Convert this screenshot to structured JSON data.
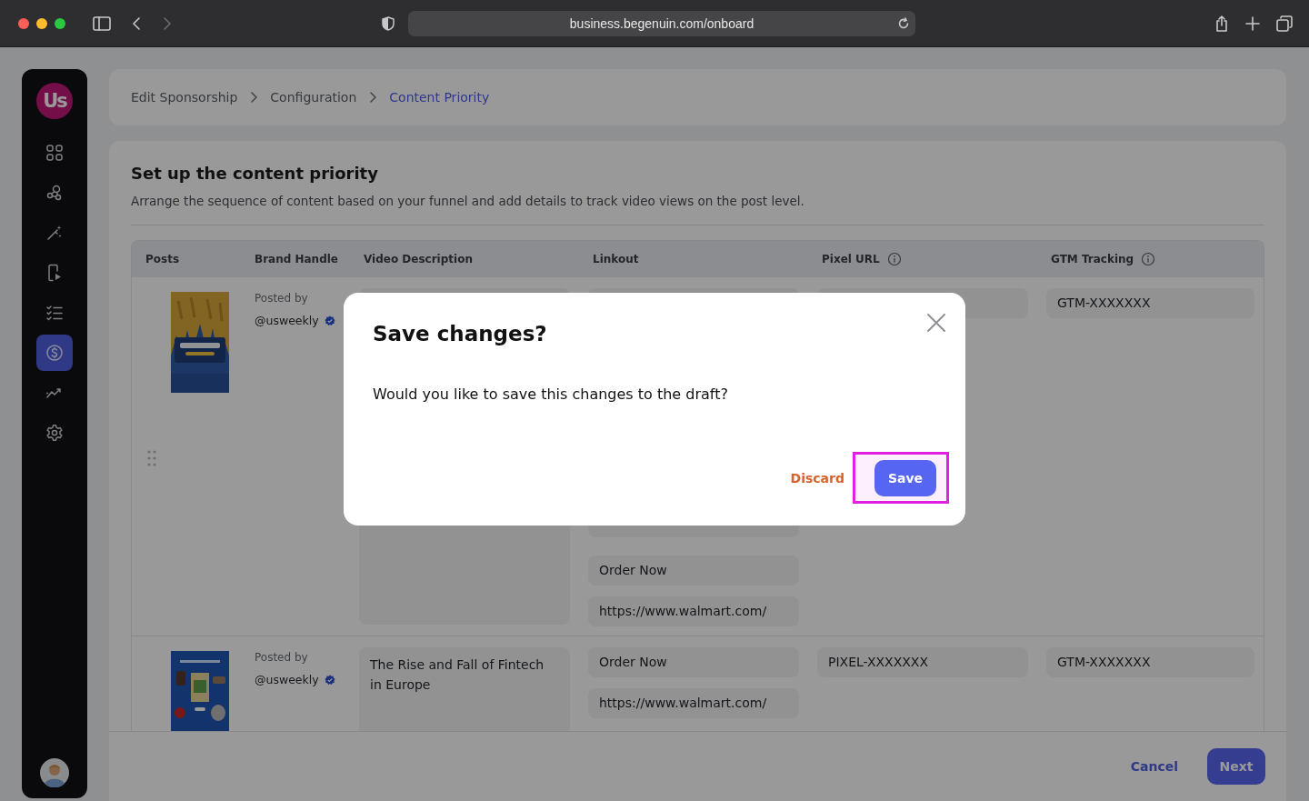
{
  "browser": {
    "url": "business.begenuin.com/onboard"
  },
  "sidebar": {
    "logo": "Us",
    "items": [
      {
        "selected": false
      },
      {
        "selected": false
      },
      {
        "selected": false
      },
      {
        "selected": false
      },
      {
        "selected": false
      },
      {
        "selected": true
      },
      {
        "selected": false
      },
      {
        "selected": false
      }
    ]
  },
  "breadcrumb": [
    {
      "label": "Edit Sponsorship",
      "current": false
    },
    {
      "label": "Configuration",
      "current": false
    },
    {
      "label": "Content Priority",
      "current": true
    }
  ],
  "section": {
    "title": "Set up the content priority",
    "description": "Arrange the sequence of content based on your funnel and add details to track video views on the post level."
  },
  "table": {
    "columns": [
      {
        "label": "Posts",
        "kind": "plain"
      },
      {
        "label": "Brand Handle",
        "kind": "plain"
      },
      {
        "label": "Video Description",
        "kind": "plain"
      },
      {
        "label": "Linkout",
        "kind": "plain"
      },
      {
        "label": "Pixel URL",
        "kind": "info"
      },
      {
        "label": "GTM Tracking",
        "kind": "info"
      }
    ],
    "rows": [
      {
        "handle_visible": true,
        "posted_by": "Posted by",
        "brand_handle": "@usweekly",
        "links": [
          {
            "kind": "covered"
          },
          {
            "kind": "covered"
          },
          {
            "kind": "covered"
          },
          {
            "kind": "link",
            "label": "Order Now",
            "url": "https://www.walmart.com/"
          }
        ],
        "gtm": "GTM-XXXXXXX"
      },
      {
        "handle_visible": false,
        "posted_by": "Posted by",
        "brand_handle": "@usweekly",
        "description": "The Rise and Fall of Fintech in Europe",
        "links": [
          {
            "kind": "link",
            "label": "Order Now",
            "url": "https://www.walmart.com/"
          }
        ],
        "pixel": "PIXEL-XXXXXXX",
        "gtm": "GTM-XXXXXXX"
      }
    ]
  },
  "footer": {
    "cancel": "Cancel",
    "next": "Next"
  },
  "dialog": {
    "title": "Save changes?",
    "message": "Would you like to save this changes to the draft?",
    "discard": "Discard",
    "save": "Save",
    "save_highlighted": true
  }
}
